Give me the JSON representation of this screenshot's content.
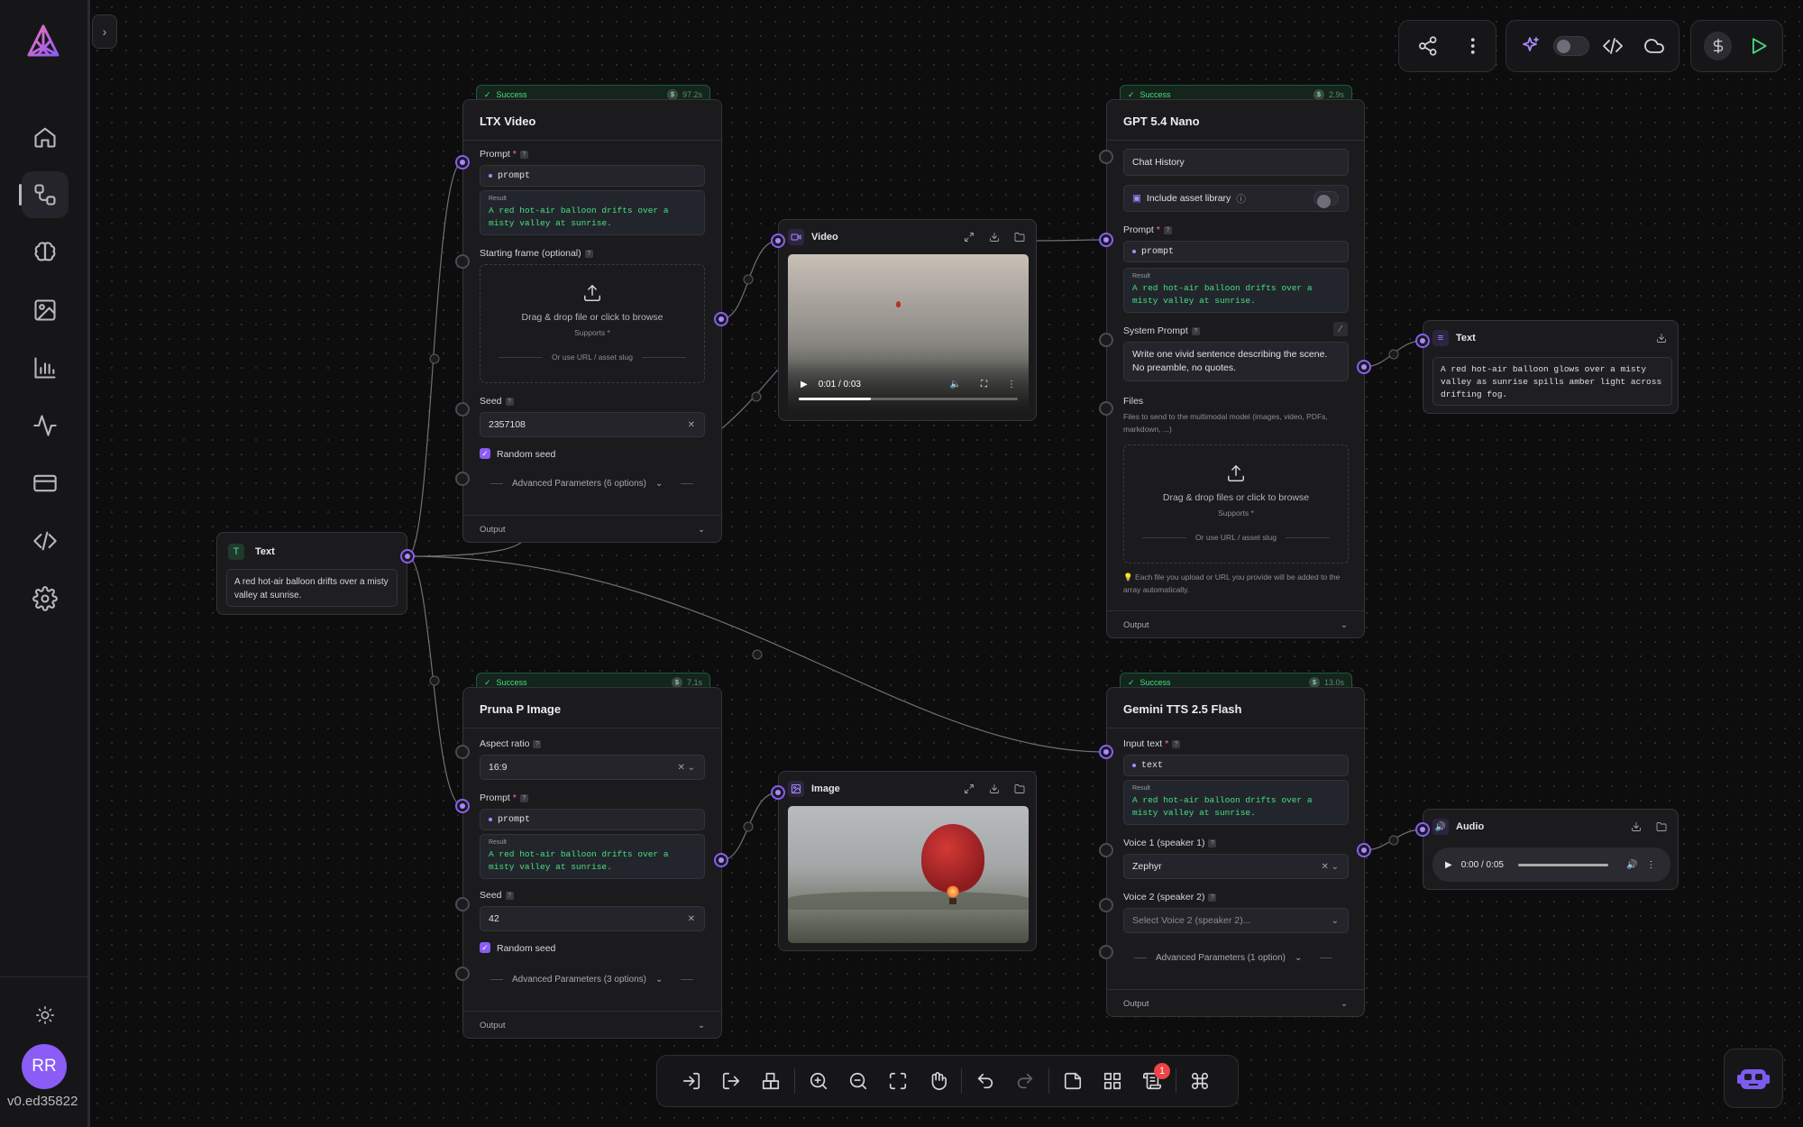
{
  "app": {
    "version": "v0.ed35822",
    "user_initials": "RR"
  },
  "sidebar": {
    "items": [
      {
        "name": "home",
        "icon": "home-icon"
      },
      {
        "name": "workflows",
        "icon": "workflow-icon",
        "active": true
      },
      {
        "name": "models",
        "icon": "brain-icon"
      },
      {
        "name": "assets",
        "icon": "image-icon"
      },
      {
        "name": "analytics",
        "icon": "bar-chart-icon"
      },
      {
        "name": "activity",
        "icon": "activity-icon"
      },
      {
        "name": "billing",
        "icon": "credit-card-icon"
      },
      {
        "name": "api",
        "icon": "code-icon"
      },
      {
        "name": "settings",
        "icon": "gear-icon"
      }
    ]
  },
  "nodes": {
    "text_input": {
      "title": "Text",
      "value": "A red hot-air balloon drifts over a misty valley at sunrise."
    },
    "ltx": {
      "status": "Success",
      "time": "97.2s",
      "title": "LTX Video",
      "prompt_label": "Prompt",
      "prompt_chip": "prompt",
      "result_label": "Result",
      "result_text": "A red hot-air balloon drifts over a misty valley at sunrise.",
      "frame_label": "Starting frame (optional)",
      "dz_text": "Drag & drop file or click to browse",
      "dz_sub": "Supports *",
      "dz_url": "Or use URL / asset slug",
      "seed_label": "Seed",
      "seed_value": "2357108",
      "random_seed": "Random seed",
      "advanced": "Advanced Parameters (6 options)",
      "output": "Output"
    },
    "video": {
      "title": "Video",
      "time": "0:01 / 0:03",
      "progress": 0.33
    },
    "gpt": {
      "status": "Success",
      "time": "2.9s",
      "title": "GPT 5.4 Nano",
      "chat_history": "Chat History",
      "asset_library": "Include asset library",
      "prompt_label": "Prompt",
      "prompt_chip": "prompt",
      "result_label": "Result",
      "result_text": "A red hot-air balloon drifts over a misty valley at sunrise.",
      "system_label": "System Prompt",
      "system_text": "Write one vivid sentence describing the scene. No preamble, no quotes.",
      "files_label": "Files",
      "files_desc": "Files to send to the multimodal model (images, video, PDFs, markdown, ...)",
      "dz_text": "Drag & drop files or click to browse",
      "dz_sub": "Supports *",
      "dz_url": "Or use URL / asset slug",
      "note": "💡 Each file you upload or URL you provide will be added to the array automatically.",
      "output": "Output"
    },
    "text_output": {
      "title": "Text",
      "value": "A red hot-air balloon glows over a misty valley as sunrise spills amber light across drifting fog."
    },
    "pruna": {
      "status": "Success",
      "time": "7.1s",
      "title": "Pruna P Image",
      "aspect_label": "Aspect ratio",
      "aspect_value": "16:9",
      "prompt_label": "Prompt",
      "prompt_chip": "prompt",
      "result_label": "Result",
      "result_text": "A red hot-air balloon drifts over a misty valley at sunrise.",
      "seed_label": "Seed",
      "seed_value": "42",
      "random_seed": "Random seed",
      "advanced": "Advanced Parameters (3 options)",
      "output": "Output"
    },
    "image": {
      "title": "Image"
    },
    "gemini": {
      "status": "Success",
      "time": "13.0s",
      "title": "Gemini TTS 2.5 Flash",
      "input_label": "Input text",
      "input_chip": "text",
      "result_label": "Result",
      "result_text": "A red hot-air balloon drifts over a misty valley at sunrise.",
      "voice1_label": "Voice 1 (speaker 1)",
      "voice1_value": "Zephyr",
      "voice2_label": "Voice 2 (speaker 2)",
      "voice2_placeholder": "Select Voice 2 (speaker 2)...",
      "advanced": "Advanced Parameters (1 option)",
      "output": "Output"
    },
    "audio": {
      "title": "Audio",
      "time": "0:00 / 0:05"
    }
  },
  "toolbar_bottom": {
    "notification_count": "1"
  },
  "colors": {
    "accent": "#8b5cf6",
    "success": "#4ade80",
    "badge": "#ef4444"
  }
}
